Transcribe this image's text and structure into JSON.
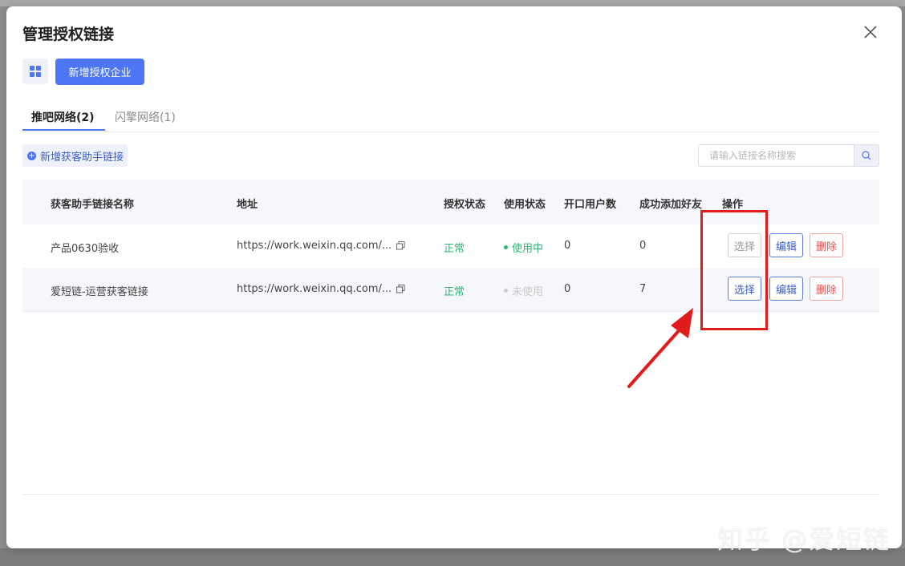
{
  "dialog": {
    "title": "管理授权链接",
    "add_enterprise_label": "新增授权企业"
  },
  "tabs": [
    {
      "label": "推吧网络(2)",
      "active": true
    },
    {
      "label": "闪擎网络(1)",
      "active": false
    }
  ],
  "toolbar": {
    "add_link_label": "新增获客助手链接",
    "search_placeholder": "请输入链接名称搜索"
  },
  "table": {
    "headers": [
      "获客助手链接名称",
      "地址",
      "授权状态",
      "使用状态",
      "开口用户数",
      "成功添加好友",
      "操作"
    ],
    "rows": [
      {
        "name": "产品0630验收",
        "url": "https://work.weixin.qq.com/...",
        "auth_status": "正常",
        "use_status": "使用中",
        "users": "0",
        "friends": "0",
        "select_label": "选择",
        "edit_label": "编辑",
        "delete_label": "删除"
      },
      {
        "name": "爱短链-运营获客链接",
        "url": "https://work.weixin.qq.com/...",
        "auth_status": "正常",
        "use_status": "未使用",
        "users": "0",
        "friends": "7",
        "select_label": "选择",
        "edit_label": "编辑",
        "delete_label": "删除"
      }
    ]
  },
  "watermark": "知乎 @爱短链",
  "colors": {
    "primary": "#4e76f4",
    "success": "#2bb673",
    "danger": "#e05a5a",
    "annotation": "#e21b1b"
  }
}
